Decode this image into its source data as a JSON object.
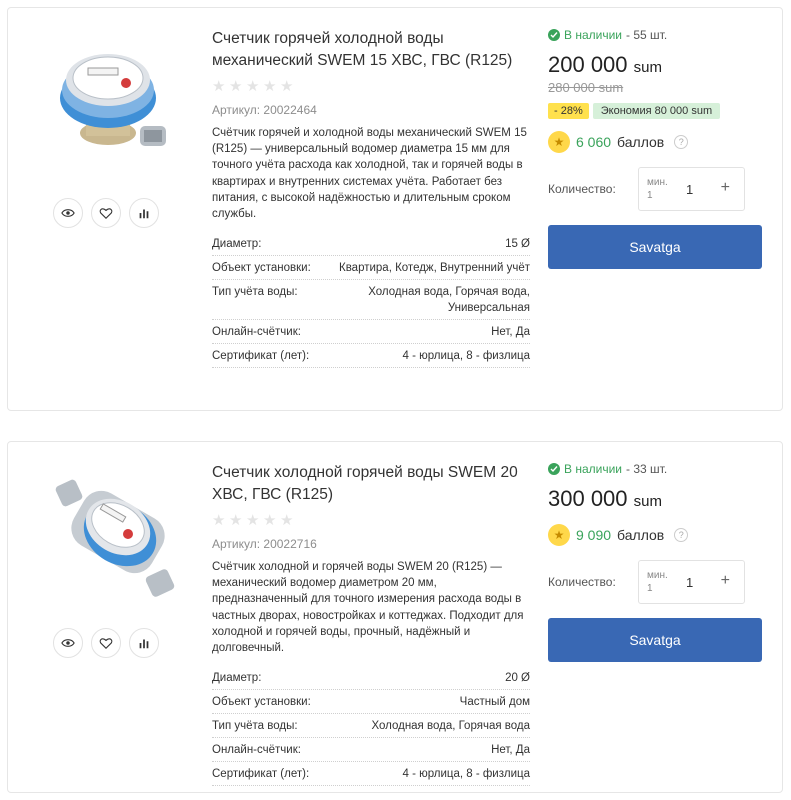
{
  "products": [
    {
      "title": "Счетчик горячей холодной воды механический SWEM 15 ХВС, ГВС (R125)",
      "sku": "Артикул: 20022464",
      "description": "Счётчик горячей и холодной воды механический SWEM 15 (R125) — универсальный водомер диаметра 15 мм для точного учёта расхода как холодной, так и горячей воды в квартирах и внутренних системах учёта. Работает без питания, с высокой надёжностью и длительным сроком службы.",
      "props": [
        {
          "name": "Диаметр:",
          "value": "15 Ø"
        },
        {
          "name": "Объект установки:",
          "value": "Квартира, Котедж, Внутренний учёт"
        },
        {
          "name": "Тип учёта воды:",
          "value": "Холодная вода, Горячая вода, Универсальная"
        },
        {
          "name": "Онлайн-счётчик:",
          "value": "Нет, Да"
        },
        {
          "name": "Сертификат (лет):",
          "value": "4 - юрлица, 8 - физлица"
        }
      ],
      "stock_label": "В наличии",
      "stock_count": "- 55 шт.",
      "price": "200 000",
      "currency": "sum",
      "old_price": "280 000 sum",
      "discount": "- 28%",
      "economy": "Экономия 80 000 sum",
      "bonus_num": "6 060",
      "bonus_label": "баллов",
      "qty_label": "Количество:",
      "qty_min": "мин. 1",
      "qty_value": "1",
      "qty_plus": "+",
      "buy_label": "Savatga"
    },
    {
      "title": "Счетчик холодной горячей воды SWEM 20 ХВС, ГВС (R125)",
      "sku": "Артикул: 20022716",
      "description": "Счётчик холодной и горячей воды SWEM 20 (R125) — механический водомер диаметром 20 мм, предназначенный для точного измерения расхода воды в частных дворах, новостройках и коттеджах. Подходит для холодной и горячей воды, прочный, надёжный и долговечный.",
      "props": [
        {
          "name": "Диаметр:",
          "value": "20 Ø"
        },
        {
          "name": "Объект установки:",
          "value": "Частный дом"
        },
        {
          "name": "Тип учёта воды:",
          "value": "Холодная вода, Горячая вода"
        },
        {
          "name": "Онлайн-счётчик:",
          "value": "Нет, Да"
        },
        {
          "name": "Сертификат (лет):",
          "value": "4 - юрлица, 8 - физлица"
        }
      ],
      "stock_label": "В наличии",
      "stock_count": "- 33 шт.",
      "price": "300 000",
      "currency": "sum",
      "bonus_num": "9 090",
      "bonus_label": "баллов",
      "qty_label": "Количество:",
      "qty_min": "мин. 1",
      "qty_value": "1",
      "qty_plus": "+",
      "buy_label": "Savatga"
    }
  ],
  "colors": {
    "accent_blue": "#3968b4",
    "in_stock_green": "#3aa35b",
    "discount_yellow": "#ffe14d",
    "economy_green_bg": "#d6f0d9"
  }
}
